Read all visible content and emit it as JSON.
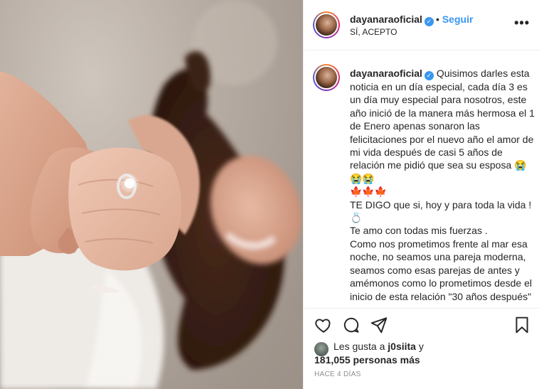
{
  "post": {
    "username": "dayanaraoficial",
    "verified_mark": "✓",
    "dot": "•",
    "follow_label": "Seguir",
    "location": "SÍ, ACEPTO",
    "more_icon": "•••"
  },
  "caption": {
    "username": "dayanaraoficial",
    "text": "Quisimos darles esta noticia en un día especial, cada día 3 es un día muy especial para nosotros, este año inició de la manera más hermosa el 1 de Enero apenas sonaron las felicitaciones por el nuevo año el amor de mi vida después de casi 5 años de relación me pidió que sea su esposa 😭😭😭\n🍁🍁🍁\nTE DIGO que si, hoy y para toda la vida ! 💍\nTe amo con todas mis fuerzas .\nComo nos prometimos frente al mar esa noche, no seamos una pareja moderna, seamos como esas parejas de antes y amémonos como lo prometimos desde el inicio de esta relación \"30 años después\""
  },
  "actions": {
    "like_icon": "heart-outline",
    "comment_icon": "speech-bubble",
    "share_icon": "paper-plane",
    "save_icon": "bookmark"
  },
  "likes": {
    "prefix": "Les gusta a ",
    "user": "j0siita",
    "connector": " y",
    "count": "181,055 personas más"
  },
  "time": "HACE 4 DÍAS",
  "colors": {
    "accent": "#3897f0",
    "text": "#262626",
    "muted": "#8e8e8e",
    "border": "#efefef"
  }
}
